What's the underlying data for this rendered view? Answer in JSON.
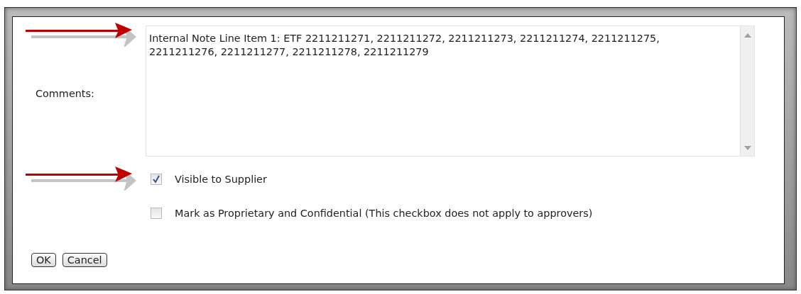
{
  "comments": {
    "label": "Comments:",
    "value": "Internal Note Line Item 1: ETF 2211211271, 2211211272, 2211211273, 2211211274, 2211211275, 2211211276, 2211211277, 2211211278, 2211211279"
  },
  "checkboxes": [
    {
      "label": "Visible to Supplier",
      "checked": true
    },
    {
      "label": "Mark as Proprietary and Confidential (This checkbox does not apply to approvers)",
      "checked": false
    }
  ],
  "buttons": [
    "OK",
    "Cancel"
  ]
}
